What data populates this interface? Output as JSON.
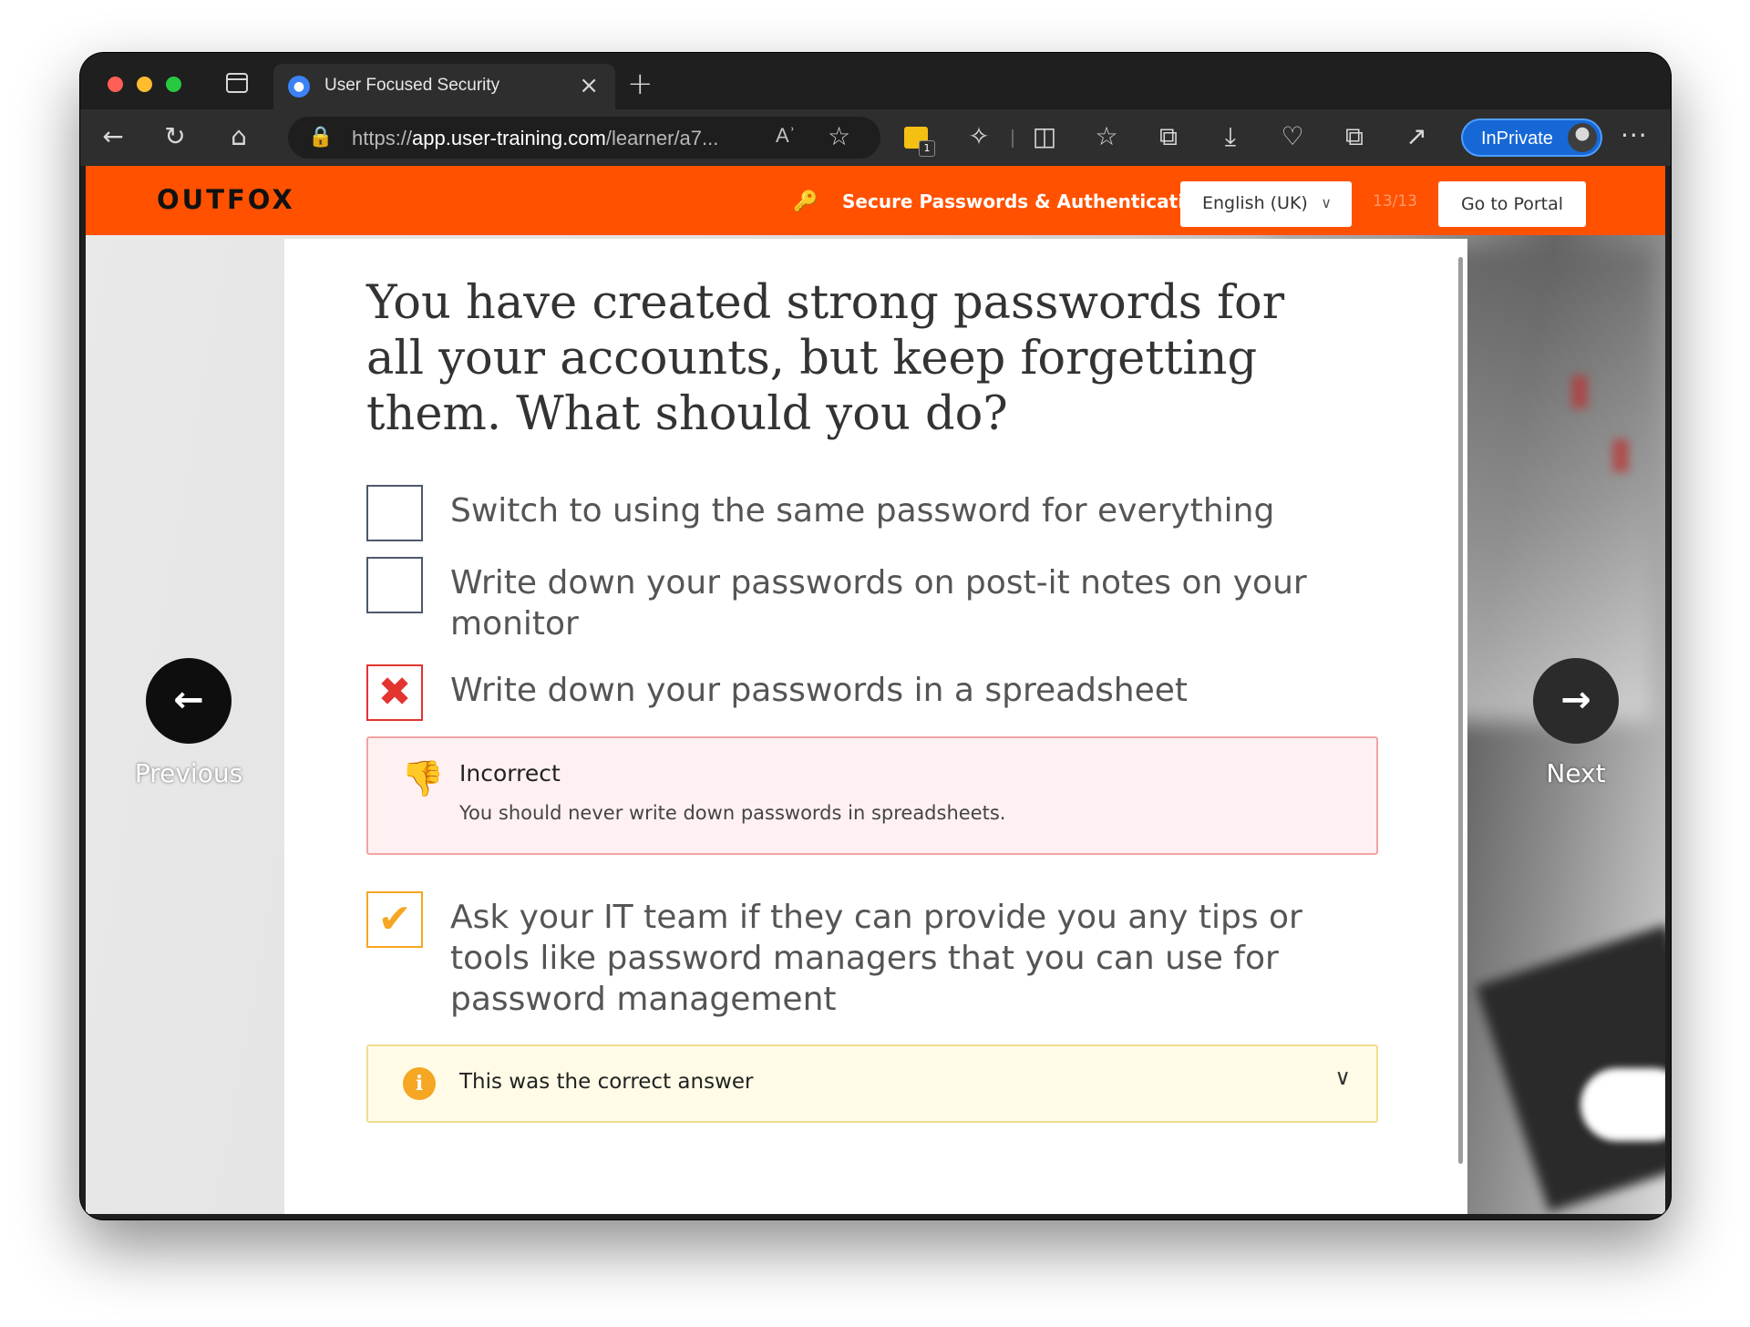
{
  "browser": {
    "tab_title": "User Focused Security",
    "url_prefix": "https://",
    "url_domain": "app.user-training.com",
    "url_path": "/learner/a7...",
    "read_aloud_icon": "Aʾ",
    "extension_badge": "1",
    "inprivate_label": "InPrivate"
  },
  "header": {
    "logo": "OUTFOX",
    "course_title": "Secure Passwords & Authentication",
    "language": "English (UK)",
    "progress": "13/13",
    "portal_button": "Go to Portal"
  },
  "question": {
    "text": "You have created strong passwords for all your accounts, but keep forgetting them. What should you do?",
    "options": [
      {
        "text": "Switch to using the same password for everything",
        "state": "unchecked"
      },
      {
        "text": "Write down your passwords on post-it notes on your monitor",
        "state": "unchecked"
      },
      {
        "text": "Write down your passwords in a spreadsheet",
        "state": "incorrect"
      },
      {
        "text": "Ask your IT team if they can provide you any tips or tools like password managers that you can use for password management",
        "state": "correct"
      }
    ],
    "feedback_incorrect": {
      "title": "Incorrect",
      "text": "You should never write down passwords in spreadsheets."
    },
    "feedback_correct": {
      "text": "This was the correct answer"
    }
  },
  "navigation": {
    "previous_label": "Previous",
    "next_label": "Next"
  },
  "colors": {
    "brand_orange": "#ff5100",
    "incorrect_red": "#e3342f",
    "correct_orange": "#f5a623",
    "inprivate_blue": "#1668d7"
  },
  "icons": [
    "tab-actions-icon",
    "back-arrow-icon",
    "refresh-icon",
    "home-icon",
    "lock-icon",
    "read-aloud-icon",
    "favorite-star-icon",
    "extension-icon",
    "puzzle-icon",
    "split-screen-icon",
    "favorites-icon",
    "collections-icon",
    "download-icon",
    "health-icon",
    "copilot-icon",
    "share-icon",
    "more-icon",
    "key-icon",
    "chevron-down-icon",
    "thumbs-down-icon",
    "info-icon",
    "arrow-left-icon",
    "arrow-right-icon"
  ]
}
